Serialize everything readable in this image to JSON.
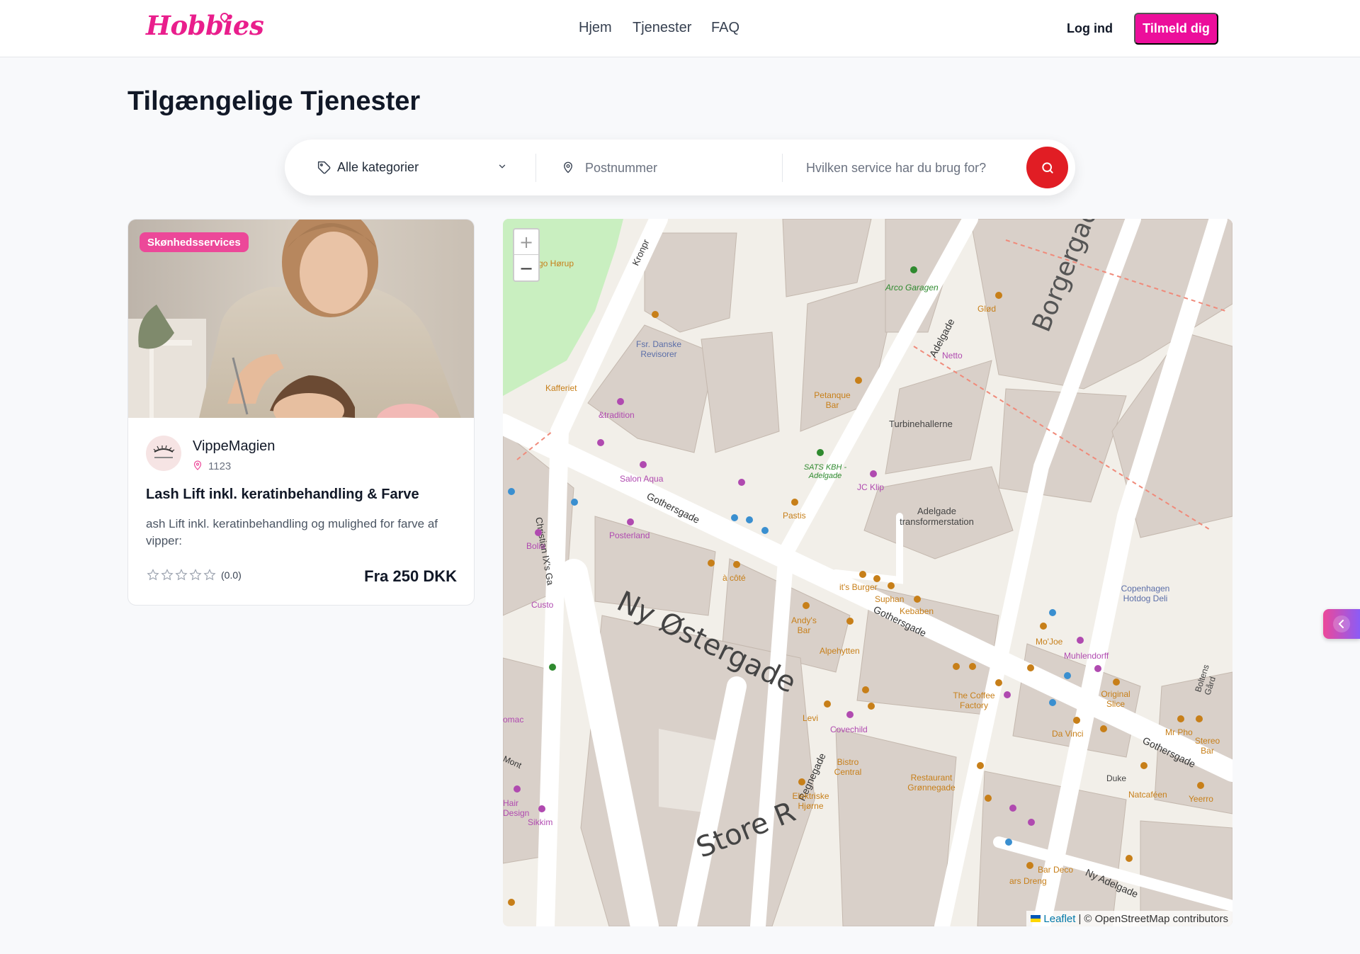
{
  "header": {
    "logo": "Hobbies",
    "nav": {
      "home": "Hjem",
      "services": "Tjenester",
      "faq": "FAQ"
    },
    "login": "Log ind",
    "signup": "Tilmeld dig"
  },
  "page": {
    "title": "Tilgængelige Tjenester"
  },
  "search": {
    "category": "Alle kategorier",
    "postal_placeholder": "Postnummer",
    "service_placeholder": "Hvilken service har du brug for?"
  },
  "card": {
    "badge": "Skønhedsservices",
    "provider_name": "VippeMagien",
    "provider_zip": "1123",
    "title": "Lash Lift inkl. keratinbehandling & Farve",
    "description": "ash Lift inkl. keratinbehandling og mulighed for farve af vipper:",
    "rating_text": "(0.0)",
    "rating_value": 0,
    "rating_max": 5,
    "price": "Fra 250 DKK"
  },
  "map": {
    "zoom_in": "+",
    "zoom_out": "−",
    "attribution_leaflet": "Leaflet",
    "attribution_separator": "|",
    "attribution_osm": "© OpenStreetMap contributors",
    "streets": {
      "borgergade": "Borgergade",
      "gothersgade1": "Gothersgade",
      "gothersgade2": "Gothersgade",
      "gothersgade3": "Gothersgade",
      "ny_ostergade": "Ny Østergade",
      "store_regnegade": "Store R",
      "regnegade": "Regnegade",
      "adelgade": "Adelgade",
      "ny_adelgade": "Ny Adelgade",
      "christian": "Christian IX's Ga",
      "kronpr": "Kronpr"
    },
    "places": {
      "arco": "Arco Garagen",
      "glod": "Glød",
      "netto": "Netto",
      "revisorer": "Fsr. Danske Revisorer",
      "kafferiet": "Kafferiet",
      "tradition": "&tradition",
      "salon_aqua": "Salon Aqua",
      "petanque": "Petanque Bar",
      "turbine": "Turbinehallerne",
      "sats": "SATS KBH - Adelgade",
      "jc_klip": "JC Klip",
      "pastis": "Pastis",
      "adelgade_station": "Adelgade transformerstation",
      "posterland": "Posterland",
      "bolia": "Bolia",
      "a_cote": "à côté",
      "its_burger": "it's Burger",
      "suphan": "Suphan",
      "kebaben": "Kebaben",
      "copenhagen_hotdog": "Copenhagen Hotdog Deli",
      "andys": "Andy's Bar",
      "alpehytten": "Alpehytten",
      "mojoe": "Mo'Joe",
      "muhlendorff": "Muhlendorff",
      "coffee_factory": "The Coffee Factory",
      "original_slice": "Original Slice",
      "covechild": "Covechild",
      "da_vinci": "Da Vinci",
      "mr_pho": "Mr Pho",
      "stereo_bar": "Stereo Bar",
      "bistro": "Bistro Central",
      "restaurant": "Restaurant Grønnegade",
      "duke": "Duke",
      "natcafeen": "Natcaféen",
      "yeerro": "Yeerro",
      "elektriske": "Elektriske Hjørne",
      "hair_design": "Hair Design",
      "sikkim": "Sikkim",
      "bar_deco": "Bar Deco",
      "dreng": "ars Dreng",
      "boltens": "Boltens Gård",
      "lev": "Levi",
      "horup": "go Hørup",
      "custo": "Custo",
      "omac": "omac",
      "mont": "Mont"
    }
  }
}
